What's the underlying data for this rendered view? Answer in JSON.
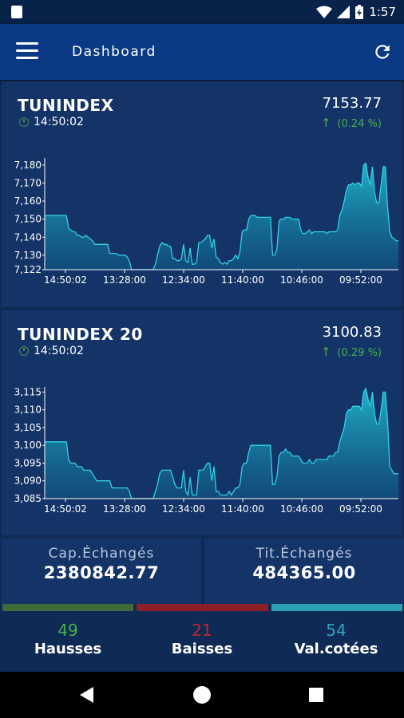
{
  "status_bar": {
    "time": "1:57"
  },
  "app_bar": {
    "title": "Dashboard"
  },
  "colors": {
    "accent_green": "#49b04e",
    "accent_red": "#c0262e",
    "accent_teal": "#2aa6bd",
    "area_fill": "#22b7cc",
    "bar_green": "#3f6b3a",
    "bar_red": "#8e1f26",
    "bar_teal": "#2aa0b2"
  },
  "indices": [
    {
      "name": "TUNINDEX",
      "time": "14:50:02",
      "value": "7153.77",
      "change": "(0.24 %)",
      "chart_data": {
        "type": "area",
        "title": "",
        "xlabel": "",
        "ylabel": "",
        "ylim": [
          7122,
          7183
        ],
        "yticks": [
          "7,180",
          "7,170",
          "7,160",
          "7,150",
          "7,140",
          "7,130",
          "7,122"
        ],
        "ytick_values": [
          7180,
          7170,
          7160,
          7150,
          7140,
          7130,
          7122
        ],
        "xticks": [
          "14:50:02",
          "13:28:00",
          "12:34:00",
          "11:40:00",
          "10:46:00",
          "09:52:00"
        ],
        "grid": false,
        "series": [
          {
            "values": [
              7152,
              7152,
              7152,
              7152,
              7152,
              7152,
              7152,
              7152,
              7152,
              7152,
              7152,
              7145,
              7144,
              7143,
              7143,
              7141,
              7141,
              7140,
              7140,
              7141,
              7140,
              7139,
              7138,
              7136,
              7136,
              7136,
              7136,
              7136,
              7136,
              7136,
              7131,
              7131,
              7131,
              7131,
              7130,
              7130,
              7130,
              7130,
              7129,
              7127,
              7122,
              7122,
              7122,
              7122,
              7122,
              7122,
              7122,
              7122,
              7122,
              7122,
              7122,
              7125,
              7130,
              7135,
              7137,
              7136,
              7136,
              7135,
              7135,
              7128,
              7128,
              7127,
              7127,
              7128,
              7136,
              7127,
              7126,
              7134,
              7125,
              7125,
              7126,
              7137,
              7137,
              7138,
              7139,
              7141,
              7141,
              7134,
              7139,
              7129,
              7128,
              7126,
              7125,
              7126,
              7125,
              7127,
              7127,
              7128,
              7130,
              7128,
              7132,
              7143,
              7144,
              7144,
              7150,
              7152,
              7152,
              7152,
              7151,
              7151,
              7151,
              7151,
              7151,
              7151,
              7151,
              7130,
              7130,
              7133,
              7149,
              7150,
              7150,
              7151,
              7151,
              7151,
              7150,
              7150,
              7150,
              7150,
              7144,
              7142,
              7142,
              7143,
              7144,
              7142,
              7143,
              7143,
              7143,
              7143,
              7143,
              7143,
              7142,
              7143,
              7143,
              7143,
              7143,
              7144,
              7152,
              7155,
              7160,
              7166,
              7169,
              7169,
              7170,
              7169,
              7170,
              7170,
              7168,
              7180,
              7181,
              7173,
              7169,
              7179,
              7165,
              7159,
              7159,
              7169,
              7179,
              7179,
              7157,
              7143,
              7140,
              7139,
              7138,
              7138
            ]
          }
        ]
      }
    },
    {
      "name": "TUNINDEX 20",
      "time": "14:50:02",
      "value": "3100.83",
      "change": "(0.29 %)",
      "chart_data": {
        "type": "area",
        "title": "",
        "xlabel": "",
        "ylabel": "",
        "ylim": [
          3085,
          3116
        ],
        "yticks": [
          "3,115",
          "3,110",
          "3,105",
          "3,100",
          "3,095",
          "3,090",
          "3,085"
        ],
        "ytick_values": [
          3115,
          3110,
          3105,
          3100,
          3095,
          3090,
          3085
        ],
        "xticks": [
          "14:50:02",
          "13:28:00",
          "12:34:00",
          "11:40:00",
          "10:46:00",
          "09:52:00"
        ],
        "grid": false,
        "series": [
          {
            "values": [
              3101,
              3101,
              3101,
              3101,
              3101,
              3101,
              3101,
              3101,
              3101,
              3101,
              3101,
              3096,
              3095,
              3095,
              3095,
              3094,
              3094,
              3094,
              3093,
              3093,
              3093,
              3093,
              3092,
              3091,
              3090,
              3090,
              3090,
              3090,
              3090,
              3090,
              3090,
              3088,
              3088,
              3088,
              3088,
              3088,
              3088,
              3088,
              3088,
              3087,
              3085,
              3085,
              3085,
              3085,
              3085,
              3085,
              3085,
              3085,
              3085,
              3085,
              3085,
              3087,
              3089,
              3092,
              3093,
              3093,
              3093,
              3093,
              3093,
              3091,
              3089,
              3088,
              3088,
              3088,
              3093,
              3087,
              3086,
              3091,
              3086,
              3086,
              3086,
              3093,
              3093,
              3093,
              3094,
              3095,
              3095,
              3090,
              3094,
              3087,
              3087,
              3086,
              3086,
              3086,
              3086,
              3087,
              3086,
              3087,
              3088,
              3088,
              3089,
              3094,
              3095,
              3095,
              3098,
              3100,
              3100,
              3100,
              3100,
              3100,
              3100,
              3100,
              3100,
              3100,
              3100,
              3089,
              3089,
              3091,
              3097,
              3098,
              3098,
              3099,
              3098,
              3098,
              3097,
              3097,
              3097,
              3097,
              3096,
              3095,
              3095,
              3095,
              3096,
              3095,
              3095,
              3096,
              3096,
              3096,
              3096,
              3096,
              3096,
              3097,
              3097,
              3097,
              3098,
              3098,
              3101,
              3103,
              3105,
              3109,
              3110,
              3110,
              3111,
              3111,
              3111,
              3111,
              3110,
              3115,
              3116,
              3113,
              3111,
              3115,
              3109,
              3106,
              3106,
              3110,
              3115,
              3115,
              3107,
              3094,
              3093,
              3092,
              3092,
              3092
            ]
          }
        ]
      }
    }
  ],
  "stats": {
    "cap": {
      "label": "Cap.Échangés",
      "value": "2380842.77"
    },
    "tit": {
      "label": "Tit.Échangés",
      "value": "484365.00"
    }
  },
  "counts": {
    "hausses": {
      "value": "49",
      "label": "Hausses"
    },
    "baisses": {
      "value": "21",
      "label": "Baisses"
    },
    "cotees": {
      "value": "54",
      "label": "Val.cotées"
    }
  }
}
